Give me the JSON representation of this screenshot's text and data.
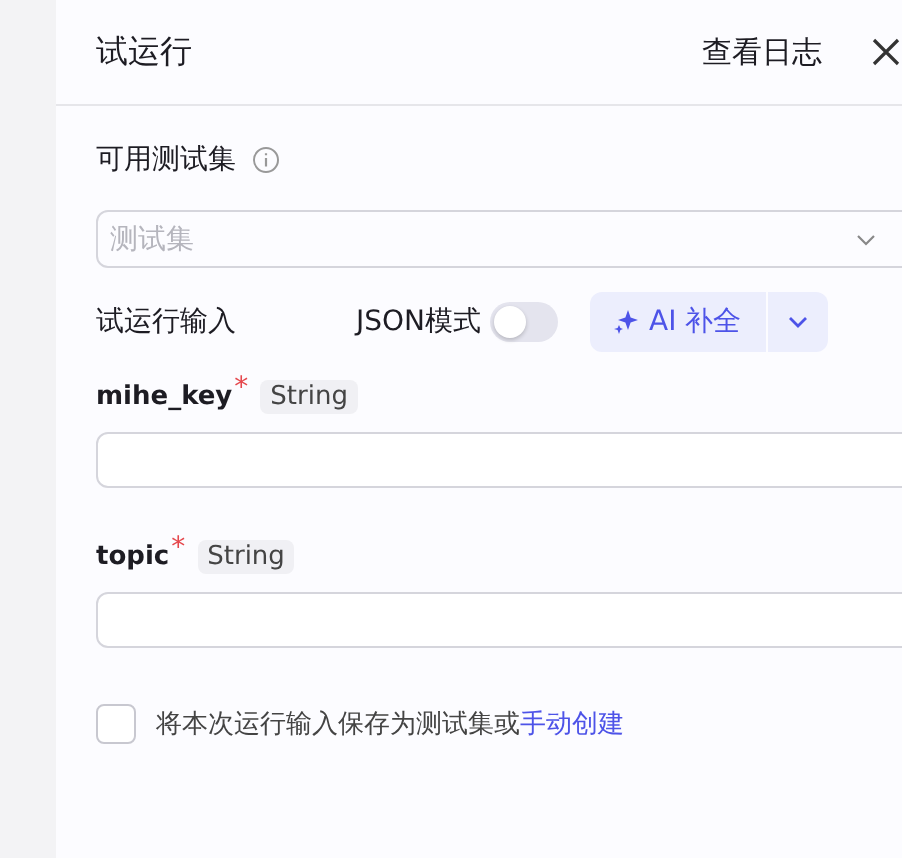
{
  "drawer": {
    "title": "试运行",
    "log_link": "查看日志"
  },
  "test_set": {
    "label": "可用测试集",
    "placeholder": "测试集"
  },
  "run_input": {
    "label": "试运行输入",
    "json_mode": {
      "label": "JSON模式",
      "on": false
    },
    "ai_button": "AI 补全"
  },
  "params": [
    {
      "name": "mihe_key",
      "required_mark": "*",
      "type": "String"
    },
    {
      "name": "topic",
      "required_mark": "*",
      "type": "String"
    }
  ],
  "save_option": {
    "checked": false,
    "text": "将本次运行输入保存为测试集或",
    "link": "手动创建"
  }
}
